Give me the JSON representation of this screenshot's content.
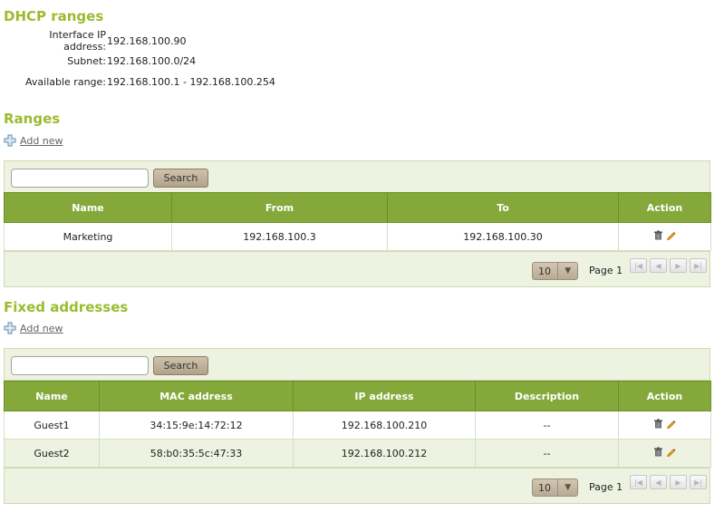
{
  "dhcp": {
    "title": "DHCP ranges",
    "info": [
      {
        "label": "Interface IP address:",
        "value": "192.168.100.90"
      },
      {
        "label": "Subnet:",
        "value": "192.168.100.0/24"
      },
      {
        "label": "Available range:",
        "value": "192.168.100.1 - 192.168.100.254"
      }
    ]
  },
  "ranges": {
    "title": "Ranges",
    "add_new": "Add new",
    "search_value": "",
    "search_button": "Search",
    "columns": [
      "Name",
      "From",
      "To",
      "Action"
    ],
    "rows": [
      {
        "name": "Marketing",
        "from": "192.168.100.3",
        "to": "192.168.100.30"
      }
    ],
    "page_size": "10",
    "page_label": "Page 1"
  },
  "fixed": {
    "title": "Fixed addresses",
    "add_new": "Add new",
    "search_value": "",
    "search_button": "Search",
    "columns": [
      "Name",
      "MAC address",
      "IP address",
      "Description",
      "Action"
    ],
    "rows": [
      {
        "name": "Guest1",
        "mac": "34:15:9e:14:72:12",
        "ip": "192.168.100.210",
        "description": "--"
      },
      {
        "name": "Guest2",
        "mac": "58:b0:35:5c:47:33",
        "ip": "192.168.100.212",
        "description": "--"
      }
    ],
    "page_size": "10",
    "page_label": "Page 1"
  },
  "icons": {
    "add": "plus-icon",
    "delete": "trash-icon",
    "edit": "pencil-icon",
    "first": "first-page-icon",
    "prev": "prev-page-icon",
    "next": "next-page-icon",
    "last": "last-page-icon",
    "dropdown": "chevron-down-icon"
  },
  "colors": {
    "heading": "#9cbb2f",
    "table_header": "#84a93a",
    "panel_bg": "#edf3e0"
  }
}
